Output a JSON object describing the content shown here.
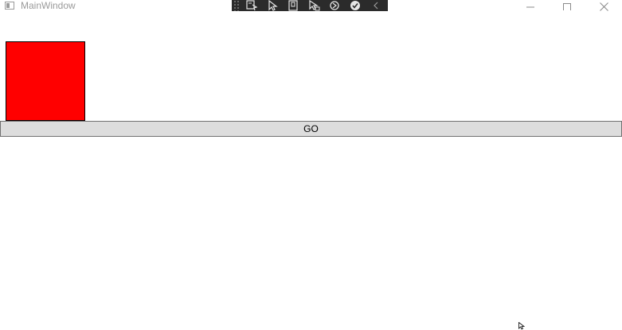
{
  "window": {
    "title": "MainWindow",
    "icon": "app-window-icon"
  },
  "window_controls": [
    "minimize-icon",
    "maximize-icon",
    "close-icon"
  ],
  "debug_toolbar": {
    "icons": [
      "select-element-icon",
      "select-pointer-icon",
      "layout-adorner-icon",
      "track-focus-icon",
      "hot-reload-icon",
      "check-icon",
      "collapse-chevron-icon"
    ]
  },
  "main": {
    "shape_color": "#ff0000",
    "button_label": "GO"
  }
}
